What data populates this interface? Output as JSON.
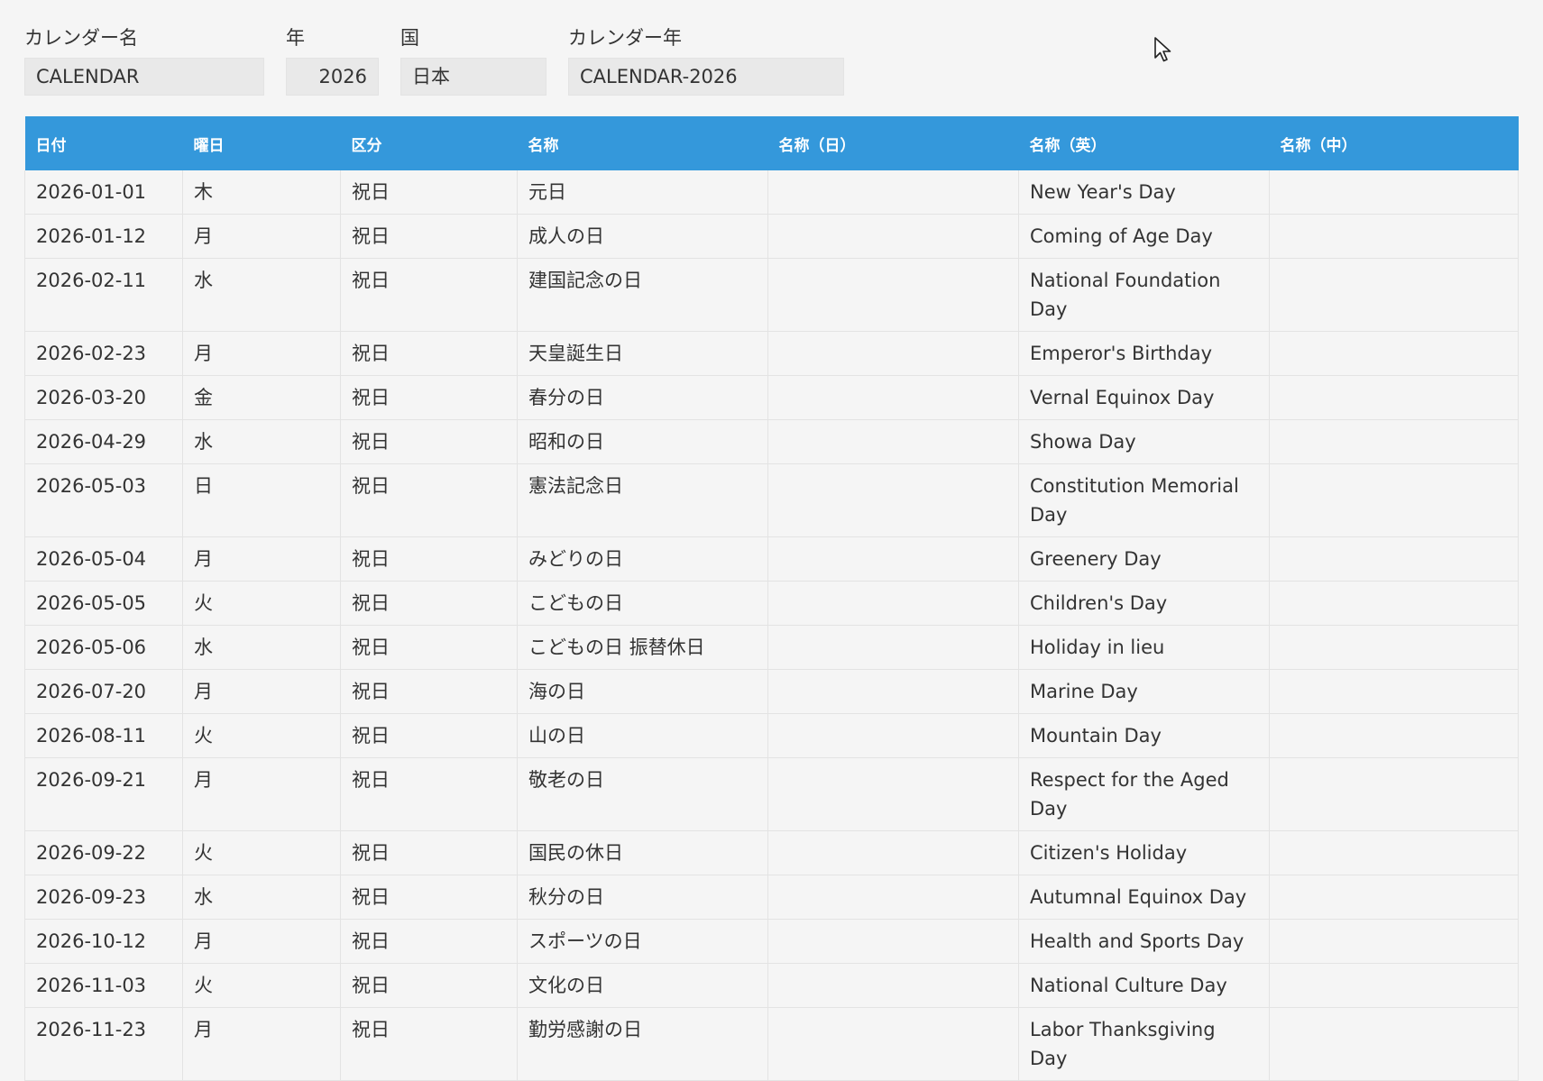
{
  "form": {
    "calendar_name": {
      "label": "カレンダー名",
      "value": "CALENDAR"
    },
    "year": {
      "label": "年",
      "value": "2026"
    },
    "country": {
      "label": "国",
      "value": "日本"
    },
    "calendar_year": {
      "label": "カレンダー年",
      "value": "CALENDAR-2026"
    }
  },
  "table": {
    "headers": [
      "日付",
      "曜日",
      "区分",
      "名称",
      "名称（日）",
      "名称（英）",
      "名称（中）"
    ],
    "header_color": "#3498db",
    "rows": [
      {
        "date": "2026-01-01",
        "dow": "木",
        "kbn": "祝日",
        "name": "元日",
        "name_ja": "",
        "name_en": "New Year's Day",
        "name_zh": ""
      },
      {
        "date": "2026-01-12",
        "dow": "月",
        "kbn": "祝日",
        "name": "成人の日",
        "name_ja": "",
        "name_en": "Coming of Age Day",
        "name_zh": ""
      },
      {
        "date": "2026-02-11",
        "dow": "水",
        "kbn": "祝日",
        "name": "建国記念の日",
        "name_ja": "",
        "name_en": "National Foundation Day",
        "name_zh": ""
      },
      {
        "date": "2026-02-23",
        "dow": "月",
        "kbn": "祝日",
        "name": "天皇誕生日",
        "name_ja": "",
        "name_en": "Emperor's Birthday",
        "name_zh": ""
      },
      {
        "date": "2026-03-20",
        "dow": "金",
        "kbn": "祝日",
        "name": "春分の日",
        "name_ja": "",
        "name_en": "Vernal Equinox Day",
        "name_zh": ""
      },
      {
        "date": "2026-04-29",
        "dow": "水",
        "kbn": "祝日",
        "name": "昭和の日",
        "name_ja": "",
        "name_en": "Showa Day",
        "name_zh": ""
      },
      {
        "date": "2026-05-03",
        "dow": "日",
        "kbn": "祝日",
        "name": "憲法記念日",
        "name_ja": "",
        "name_en": "Constitution Memorial Day",
        "name_zh": ""
      },
      {
        "date": "2026-05-04",
        "dow": "月",
        "kbn": "祝日",
        "name": "みどりの日",
        "name_ja": "",
        "name_en": "Greenery Day",
        "name_zh": ""
      },
      {
        "date": "2026-05-05",
        "dow": "火",
        "kbn": "祝日",
        "name": "こどもの日",
        "name_ja": "",
        "name_en": "Children's Day",
        "name_zh": ""
      },
      {
        "date": "2026-05-06",
        "dow": "水",
        "kbn": "祝日",
        "name": "こどもの日 振替休日",
        "name_ja": "",
        "name_en": "Holiday in lieu",
        "name_zh": ""
      },
      {
        "date": "2026-07-20",
        "dow": "月",
        "kbn": "祝日",
        "name": "海の日",
        "name_ja": "",
        "name_en": "Marine Day",
        "name_zh": ""
      },
      {
        "date": "2026-08-11",
        "dow": "火",
        "kbn": "祝日",
        "name": "山の日",
        "name_ja": "",
        "name_en": "Mountain Day",
        "name_zh": ""
      },
      {
        "date": "2026-09-21",
        "dow": "月",
        "kbn": "祝日",
        "name": "敬老の日",
        "name_ja": "",
        "name_en": "Respect for the Aged Day",
        "name_zh": ""
      },
      {
        "date": "2026-09-22",
        "dow": "火",
        "kbn": "祝日",
        "name": "国民の休日",
        "name_ja": "",
        "name_en": "Citizen's Holiday",
        "name_zh": ""
      },
      {
        "date": "2026-09-23",
        "dow": "水",
        "kbn": "祝日",
        "name": "秋分の日",
        "name_ja": "",
        "name_en": "Autumnal Equinox Day",
        "name_zh": ""
      },
      {
        "date": "2026-10-12",
        "dow": "月",
        "kbn": "祝日",
        "name": "スポーツの日",
        "name_ja": "",
        "name_en": "Health and Sports Day",
        "name_zh": ""
      },
      {
        "date": "2026-11-03",
        "dow": "火",
        "kbn": "祝日",
        "name": "文化の日",
        "name_ja": "",
        "name_en": "National Culture Day",
        "name_zh": ""
      },
      {
        "date": "2026-11-23",
        "dow": "月",
        "kbn": "祝日",
        "name": "勤労感謝の日",
        "name_ja": "",
        "name_en": "Labor Thanksgiving Day",
        "name_zh": ""
      }
    ]
  },
  "icons": {
    "cursor": "mouse-pointer-icon"
  }
}
